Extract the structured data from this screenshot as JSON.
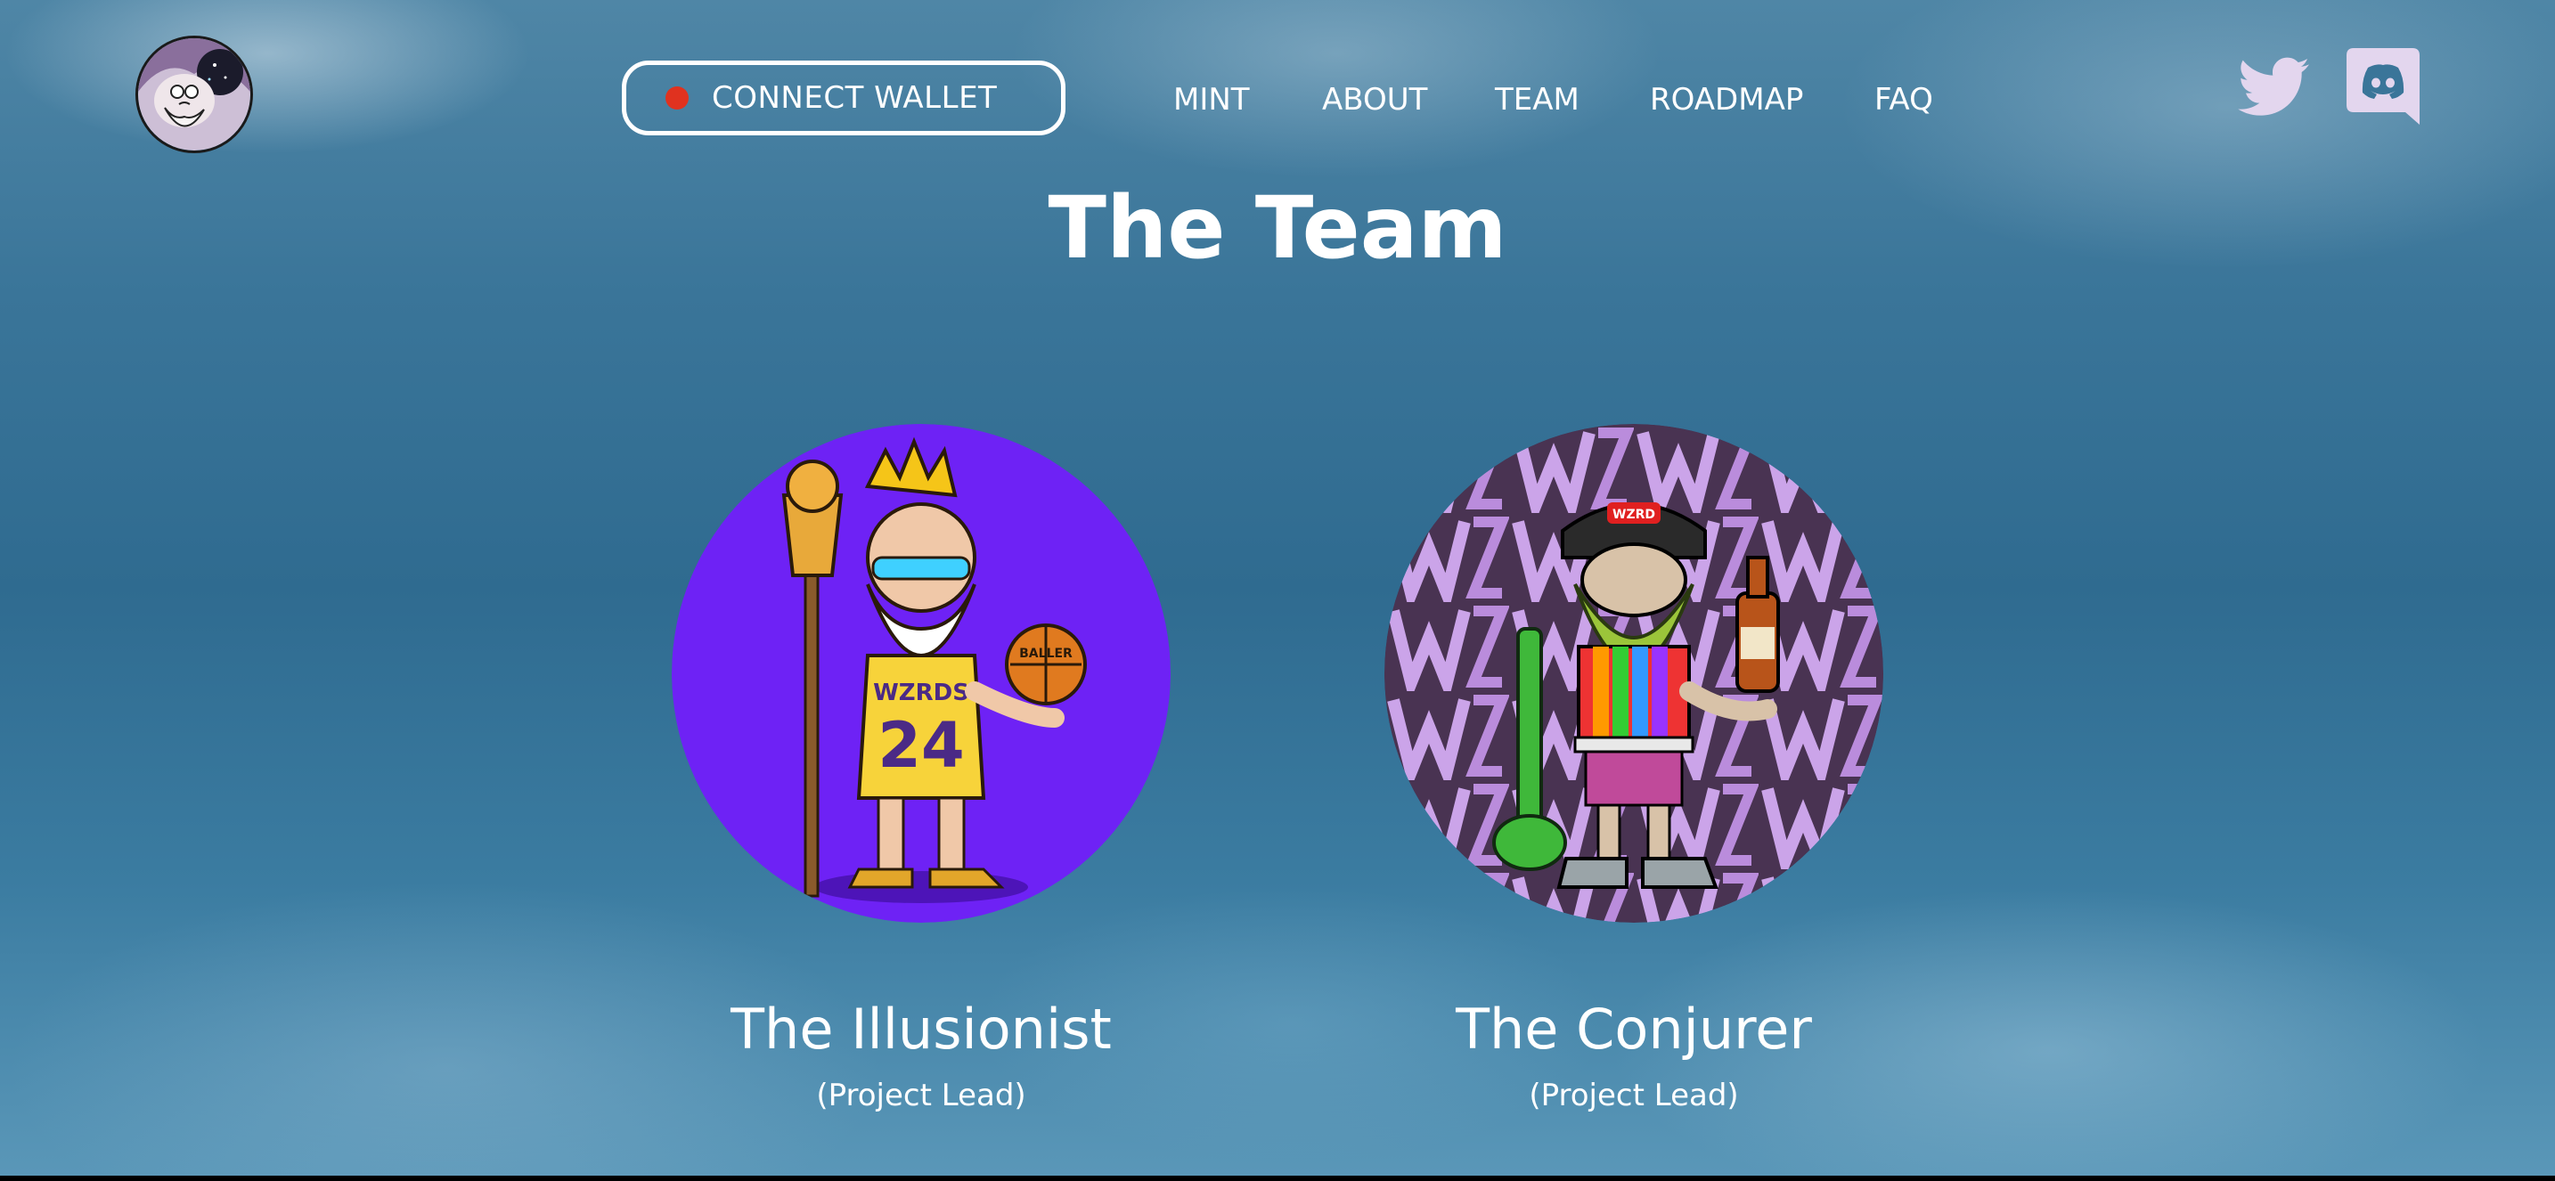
{
  "header": {
    "logo_icon": "wizard-logo",
    "connect_wallet": {
      "label": "CONNECT WALLET",
      "status_color": "#e0321f"
    },
    "nav": [
      {
        "label": "MINT"
      },
      {
        "label": "ABOUT"
      },
      {
        "label": "TEAM"
      },
      {
        "label": "ROADMAP"
      },
      {
        "label": "FAQ"
      }
    ],
    "social": [
      {
        "icon": "twitter-icon",
        "color": "#e3d6ee"
      },
      {
        "icon": "discord-icon",
        "color": "#e3d6ee"
      }
    ]
  },
  "main": {
    "title": "The Team",
    "members": [
      {
        "name": "The Illusionist",
        "role": "(Project Lead)",
        "avatar_bg": "#6e22f5",
        "jersey_text": "WZRDS",
        "jersey_number": "24",
        "ball_text": "BALLER"
      },
      {
        "name": "The Conjurer",
        "role": "(Project Lead)",
        "avatar_bg": "#2a1630",
        "cap_text": "WZRD"
      }
    ]
  }
}
